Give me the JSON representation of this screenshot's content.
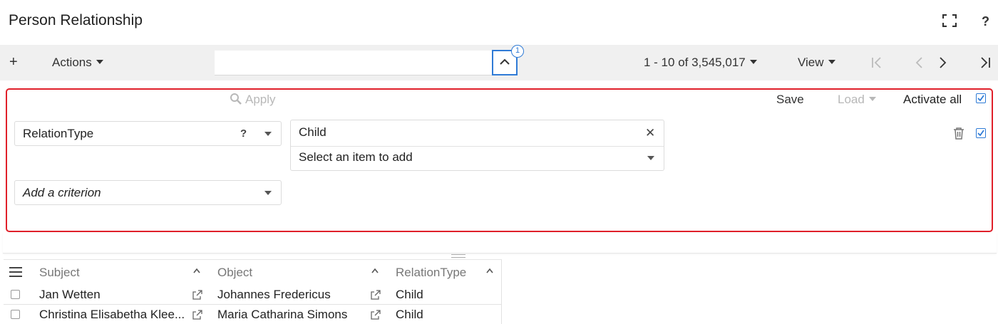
{
  "header": {
    "title": "Person Relationship",
    "help_label": "?"
  },
  "toolbar": {
    "add_label": "+",
    "actions_label": "Actions",
    "search_value": "",
    "filter_badge_count": "1",
    "pager_label": "1 - 10 of 3,545,017",
    "view_label": "View"
  },
  "filter": {
    "apply_label": "Apply",
    "save_label": "Save",
    "load_label": "Load",
    "activate_all_label": "Activate all",
    "activate_all_checked": true,
    "criteria": [
      {
        "field": "RelationType",
        "help": "?",
        "values": [
          "Child"
        ],
        "add_placeholder": "Select an item to add",
        "active": true
      }
    ],
    "add_criterion_placeholder": "Add a criterion"
  },
  "grid": {
    "columns": [
      "Subject",
      "Object",
      "RelationType"
    ],
    "rows": [
      {
        "subject": "Jan Wetten",
        "object": "Johannes Fredericus",
        "relation": "Child"
      },
      {
        "subject": "Christina Elisabetha Klee...",
        "object": "Maria Catharina Simons",
        "relation": "Child"
      }
    ]
  },
  "colors": {
    "accent": "#2f7bd6",
    "highlight_border": "#e0202a",
    "toolbar_bg": "#f0f0f0"
  },
  "icons": [
    "expand-icon",
    "help-icon",
    "plus-icon",
    "chevron-up-icon",
    "first-page-icon",
    "prev-page-icon",
    "next-page-icon",
    "last-page-icon",
    "search-icon",
    "trash-icon",
    "close-icon",
    "menu-icon",
    "sort-up-icon",
    "external-link-icon"
  ]
}
